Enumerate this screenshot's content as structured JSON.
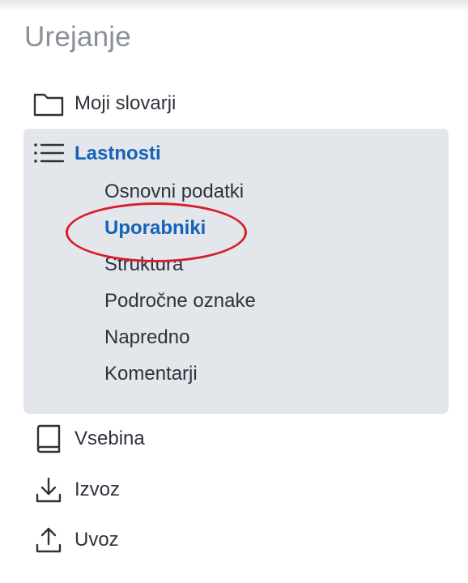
{
  "section_title": "Urejanje",
  "nav": {
    "my_dictionaries": {
      "label": "Moji slovarji",
      "icon": "folder-icon"
    },
    "properties": {
      "label": "Lastnosti",
      "icon": "list-icon",
      "sub_items": [
        {
          "label": "Osnovni podatki"
        },
        {
          "label": "Uporabniki",
          "selected": true
        },
        {
          "label": "Struktura"
        },
        {
          "label": "Področne oznake"
        },
        {
          "label": "Napredno"
        },
        {
          "label": "Komentarji"
        }
      ]
    },
    "content": {
      "label": "Vsebina",
      "icon": "book-icon"
    },
    "export": {
      "label": "Izvoz",
      "icon": "download-icon"
    },
    "import": {
      "label": "Uvoz",
      "icon": "upload-icon"
    }
  },
  "colors": {
    "accent": "#1463b5",
    "active_background": "#e3e7eb",
    "annotation": "#d71f2b",
    "text": "#2d333b",
    "title": "#8b9097"
  }
}
